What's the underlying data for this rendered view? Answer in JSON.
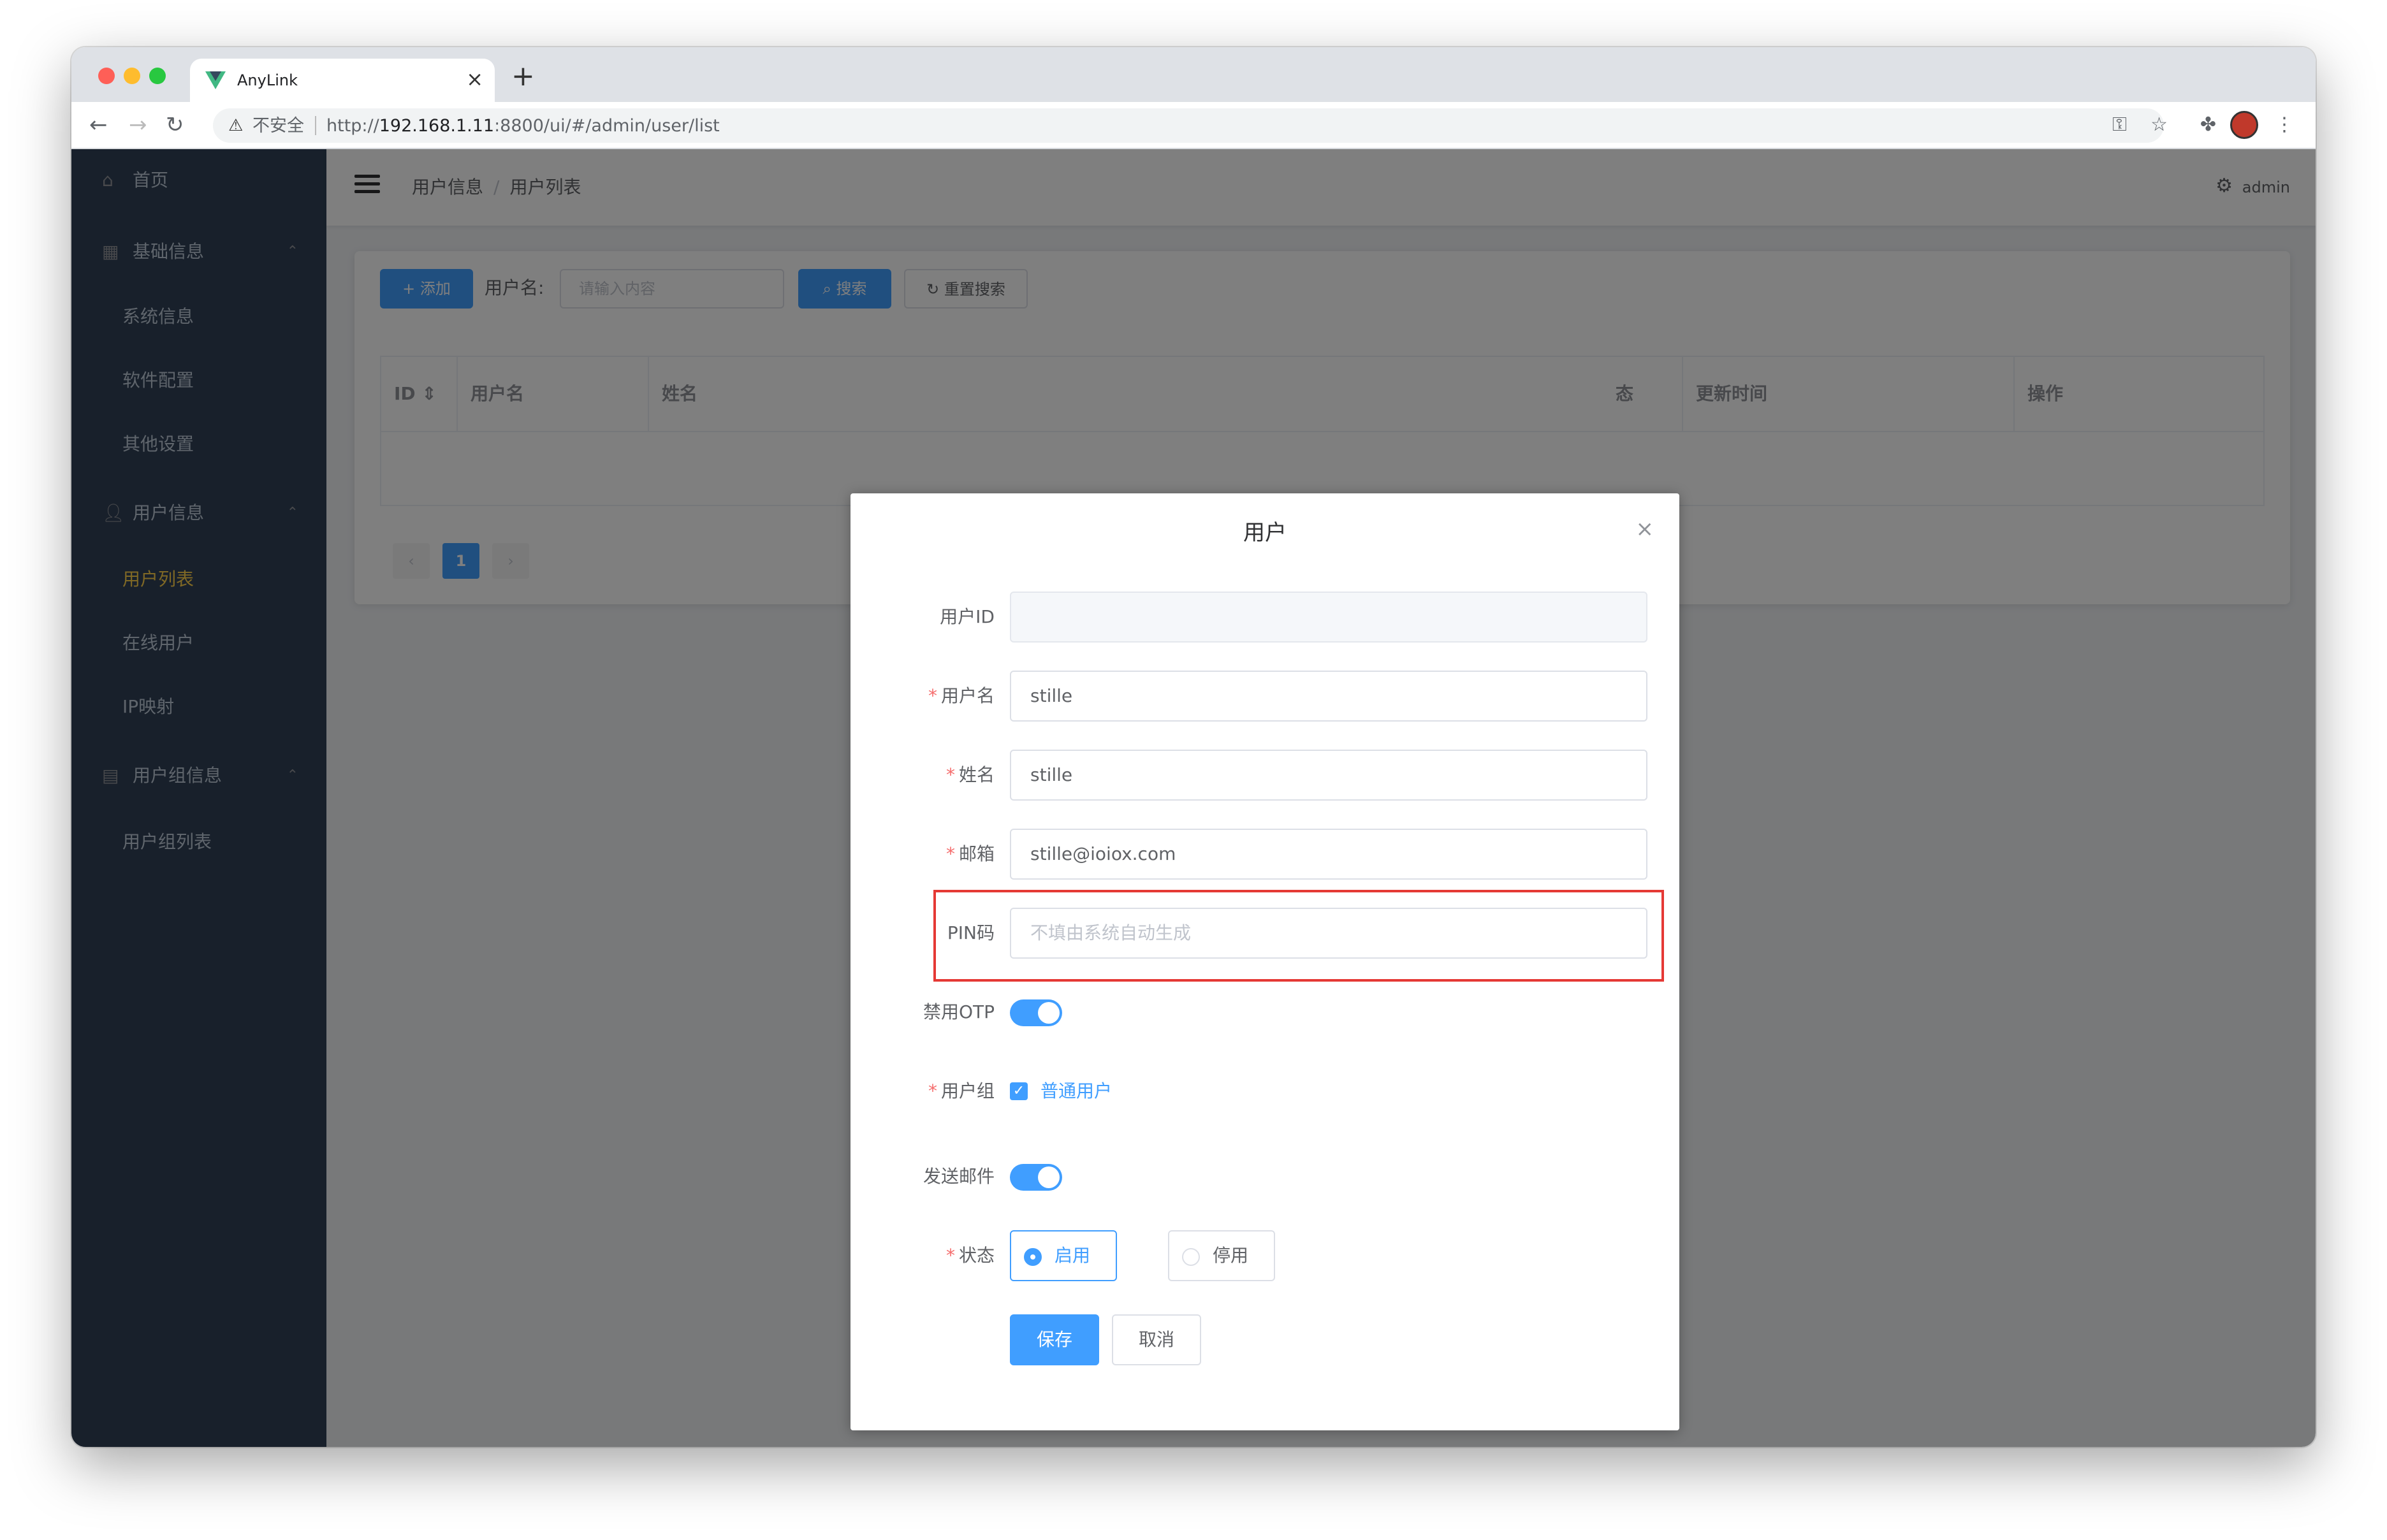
{
  "browser": {
    "tab_title": "AnyLink",
    "insecure_label": "不安全",
    "url_prefix": "http://",
    "url_host": "192.168.1.11",
    "url_rest": ":8800/ui/#/admin/user/list",
    "new_tab": "+",
    "tab_close": "×"
  },
  "sidebar": {
    "items": [
      {
        "label": "首页",
        "icon": "home-icon"
      },
      {
        "label": "基础信息",
        "icon": "grid-icon"
      },
      {
        "label": "系统信息"
      },
      {
        "label": "软件配置"
      },
      {
        "label": "其他设置"
      },
      {
        "label": "用户信息",
        "icon": "user-icon"
      },
      {
        "label": "用户列表",
        "active": true
      },
      {
        "label": "在线用户"
      },
      {
        "label": "IP映射"
      },
      {
        "label": "用户组信息",
        "icon": "group-icon"
      },
      {
        "label": "用户组列表"
      }
    ]
  },
  "header": {
    "breadcrumb": [
      "用户信息",
      "用户列表"
    ],
    "breadcrumb_divider": "/",
    "user": "admin"
  },
  "toolbar": {
    "add_label": "+ 添加",
    "search_label": "用户名:",
    "search_placeholder": "请输入内容",
    "search_button": "搜索",
    "reset_button": "重置搜索"
  },
  "table": {
    "columns": [
      "ID",
      "用户名",
      "姓名",
      "态",
      "更新时间",
      "操作"
    ]
  },
  "pagination": {
    "prev": "‹",
    "current": "1",
    "next": "›"
  },
  "dialog": {
    "title": "用户",
    "close": "×",
    "fields": {
      "user_id": {
        "label": "用户ID",
        "value": ""
      },
      "username": {
        "label": "用户名",
        "value": "stille"
      },
      "name": {
        "label": "姓名",
        "value": "stille"
      },
      "email": {
        "label": "邮箱",
        "value": "stille@ioiox.com"
      },
      "pin": {
        "label": "PIN码",
        "placeholder": "不填由系统自动生成"
      },
      "disable_otp": {
        "label": "禁用OTP",
        "checked": true
      },
      "group": {
        "label": "用户组",
        "option": "普通用户",
        "checked": true
      },
      "send_email": {
        "label": "发送邮件",
        "checked": true
      },
      "status": {
        "label": "状态",
        "options": [
          "启用",
          "停用"
        ],
        "selected": "启用"
      }
    },
    "required_mark": "*",
    "save": "保存",
    "cancel": "取消"
  },
  "colors": {
    "primary": "#409eff",
    "sidebar_bg": "#304156",
    "active_menu": "#ffd04b",
    "highlight": "#e53935"
  }
}
